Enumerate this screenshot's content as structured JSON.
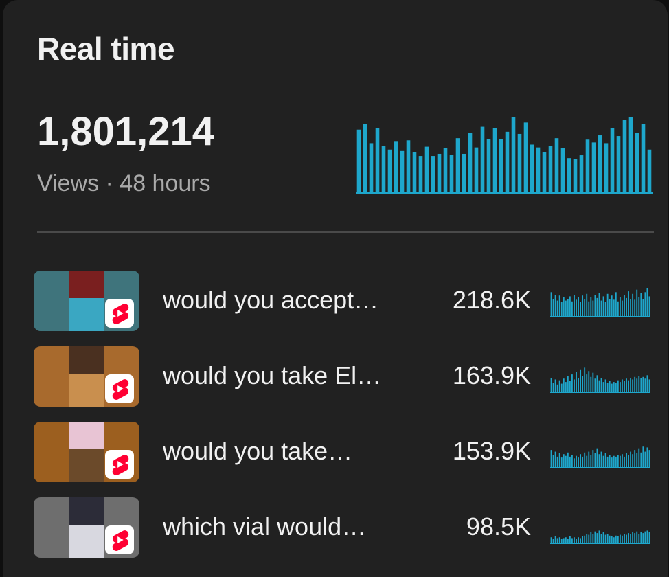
{
  "header": {
    "title": "Real time"
  },
  "summary": {
    "views": "1,801,214",
    "caption": "Views · 48 hours"
  },
  "colors": {
    "bar": "#1ea7cc",
    "background": "#212121",
    "shorts_red": "#ff0033"
  },
  "chart_data": [
    {
      "type": "bar",
      "values": [
        90,
        98,
        71,
        92,
        67,
        62,
        74,
        60,
        75,
        58,
        53,
        66,
        53,
        56,
        64,
        55,
        78,
        56,
        85,
        65,
        94,
        77,
        92,
        77,
        87,
        108,
        84,
        100,
        69,
        65,
        58,
        67,
        78,
        64,
        50,
        49,
        54,
        76,
        72,
        82,
        71,
        92,
        81,
        104,
        108,
        85,
        98,
        62
      ]
    },
    {
      "type": "bar",
      "values": [
        30,
        22,
        27,
        20,
        26,
        18,
        24,
        20,
        22,
        25,
        19,
        27,
        21,
        24,
        18,
        26,
        22,
        28,
        19,
        24,
        20,
        27,
        23,
        29,
        20,
        25,
        18,
        28,
        22,
        26,
        21,
        30,
        19,
        24,
        20,
        27,
        23,
        31,
        22,
        28,
        21,
        33,
        24,
        29,
        22,
        30,
        35,
        25
      ]
    },
    {
      "type": "bar",
      "values": [
        18,
        12,
        16,
        10,
        15,
        11,
        17,
        13,
        20,
        14,
        22,
        16,
        25,
        18,
        28,
        20,
        30,
        22,
        26,
        19,
        24,
        17,
        21,
        15,
        18,
        13,
        16,
        12,
        14,
        11,
        13,
        12,
        15,
        13,
        16,
        14,
        17,
        15,
        18,
        16,
        19,
        17,
        20,
        18,
        19,
        17,
        21,
        16
      ]
    },
    {
      "type": "bar",
      "values": [
        22,
        16,
        20,
        14,
        18,
        13,
        17,
        15,
        19,
        14,
        16,
        12,
        15,
        13,
        17,
        14,
        19,
        15,
        20,
        16,
        22,
        18,
        24,
        17,
        20,
        15,
        18,
        14,
        16,
        13,
        15,
        14,
        16,
        15,
        17,
        14,
        18,
        16,
        20,
        17,
        22,
        18,
        24,
        19,
        26,
        20,
        25,
        22
      ]
    },
    {
      "type": "bar",
      "values": [
        8,
        6,
        9,
        7,
        8,
        6,
        7,
        8,
        6,
        9,
        7,
        8,
        6,
        8,
        7,
        9,
        10,
        12,
        11,
        14,
        12,
        15,
        13,
        16,
        12,
        14,
        11,
        12,
        10,
        9,
        8,
        10,
        9,
        11,
        10,
        12,
        11,
        13,
        12,
        14,
        13,
        15,
        12,
        14,
        13,
        15,
        16,
        14
      ]
    }
  ],
  "videos": [
    {
      "title": "would you accept…",
      "views": "218.6K",
      "thumb_bg": "#3f747c",
      "pic1": "#7a1f1f",
      "pic2": "#3aa7c2"
    },
    {
      "title": "would you take El…",
      "views": "163.9K",
      "thumb_bg": "#a86a2d",
      "pic1": "#4a3020",
      "pic2": "#c98f4e"
    },
    {
      "title": "would you take…",
      "views": "153.9K",
      "thumb_bg": "#9c5f1f",
      "pic1": "#e8c4d4",
      "pic2": "#6b4a2a"
    },
    {
      "title": "which vial would…",
      "views": "98.5K",
      "thumb_bg": "#6e6e6e",
      "pic1": "#2c2c38",
      "pic2": "#d8d8e0"
    }
  ]
}
